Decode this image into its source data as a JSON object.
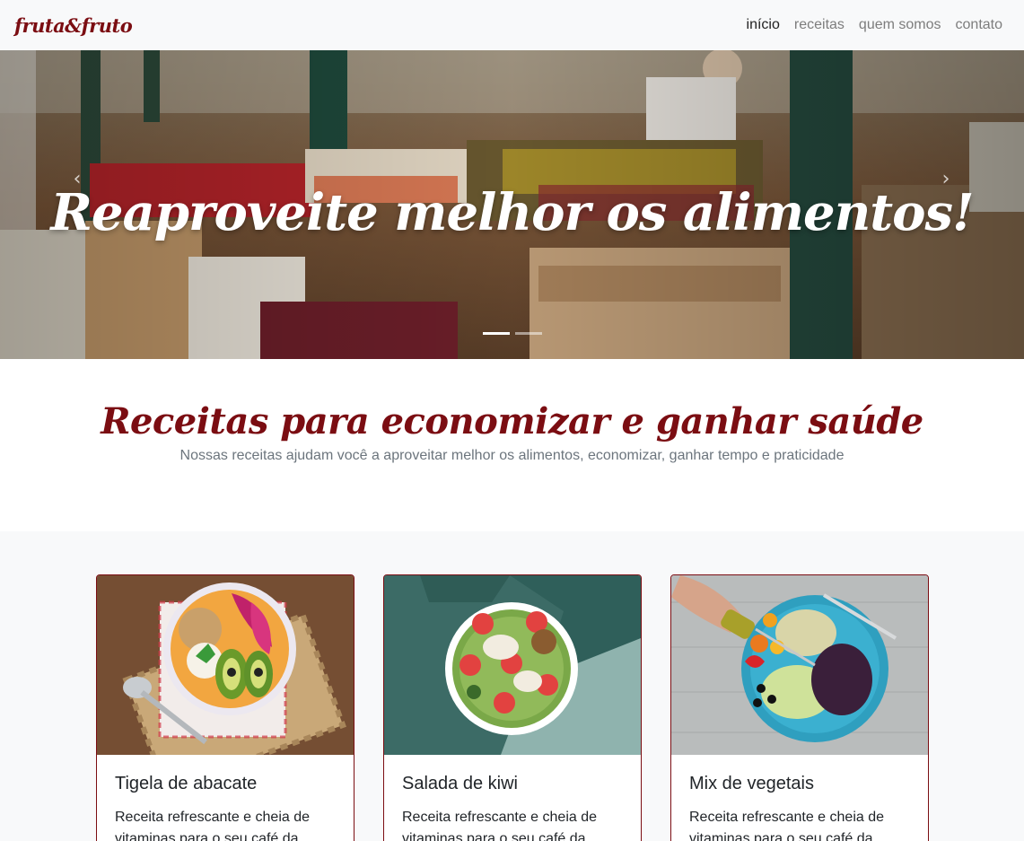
{
  "navbar": {
    "brand": "fruta&fruto",
    "links": [
      {
        "label": "início",
        "active": true
      },
      {
        "label": "receitas",
        "active": false
      },
      {
        "label": "quem somos",
        "active": false
      },
      {
        "label": "contato",
        "active": false
      }
    ]
  },
  "carousel": {
    "caption": "Reaproveite melhor os alimentos!",
    "prev_icon": "chevron-left-icon",
    "next_icon": "chevron-right-icon",
    "slide_count": 2,
    "active_slide": 1
  },
  "intro": {
    "title": "Receitas para economizar e ganhar saúde",
    "subtitle": "Nossas receitas ajudam você a aproveitar melhor os alimentos, economizar, ganhar tempo e praticidade"
  },
  "cards": [
    {
      "title": "Tigela de abacate",
      "text": "Receita refrescante e cheia de vitaminas para o seu café da manhã"
    },
    {
      "title": "Salada de kiwi",
      "text": "Receita refrescante e cheia de vitaminas para o seu café da manhã"
    },
    {
      "title": "Mix de vegetais",
      "text": "Receita refrescante e cheia de vitaminas para o seu café da manhã"
    }
  ],
  "colors": {
    "brand": "#7b0d12",
    "navbar_bg": "#f8f9fa",
    "muted_text": "#6c757d"
  }
}
